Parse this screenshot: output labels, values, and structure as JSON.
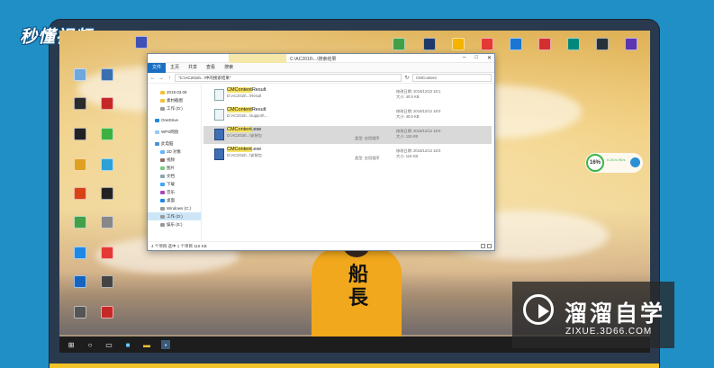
{
  "brand_logo": "秒懂视频",
  "watermark": {
    "title": "溜溜自学",
    "url": "ZIXUE.3D66.COM",
    "icon": "play-icon"
  },
  "wallpaper": {
    "shirt_text": "船長"
  },
  "explorer": {
    "title_path": "C:\\AC2016\\...\\搜索结果",
    "ribbon_tabs": [
      "文件",
      "主页",
      "共享",
      "查看",
      "搜索"
    ],
    "address": "\"C:\\AC2016\\...\\中的搜索结果\"",
    "search_value": "CMContent",
    "nav_items": [
      {
        "label": "2019.03.09",
        "icon": "folder-icon"
      },
      {
        "label": "素材截图",
        "icon": "folder-icon"
      },
      {
        "label": "工作 (D:)",
        "icon": "drive-icon"
      },
      {
        "label": "OneDrive",
        "icon": "cloud-icon"
      },
      {
        "label": "WPS网盘",
        "icon": "cloud-icon"
      },
      {
        "label": "此电脑",
        "icon": "pc-icon"
      },
      {
        "label": "3D 对象",
        "icon": "folder-icon"
      },
      {
        "label": "视频",
        "icon": "folder-icon"
      },
      {
        "label": "图片",
        "icon": "folder-icon"
      },
      {
        "label": "文档",
        "icon": "folder-icon"
      },
      {
        "label": "下载",
        "icon": "folder-icon"
      },
      {
        "label": "音乐",
        "icon": "folder-icon"
      },
      {
        "label": "桌面",
        "icon": "folder-icon"
      },
      {
        "label": "Windows (C:)",
        "icon": "drive-icon"
      },
      {
        "label": "工作 (D:)",
        "icon": "drive-icon"
      },
      {
        "label": "娱乐 (E:)",
        "icon": "drive-icon"
      }
    ],
    "files": [
      {
        "name_hl": "CMContent",
        "name_rest": "Result",
        "path": "D:\\AC2016\\...\\Result",
        "kind": "",
        "date": "修改日期: 2016/12/22 18:1",
        "size": "大小: 40.5 KB"
      },
      {
        "name_hl": "CMContent",
        "name_rest": "Result",
        "path": "D:\\AC2016\\...\\support\\...",
        "kind": "",
        "date": "修改日期: 2016/12/12 18:0",
        "size": "大小: 40.5 KB"
      },
      {
        "name_hl": "CMContent",
        "name_rest": ".exe",
        "path": "D:\\AC2016\\...\\安装包",
        "kind": "类型: 应用程序",
        "date": "修改日期: 2016/12/12 18:0",
        "size": "大小: 115 KB"
      },
      {
        "name_hl": "CMContent",
        "name_rest": ".exe",
        "path": "D:\\AC2016\\...\\安装包",
        "kind": "类型: 应用程序",
        "date": "修改日期: 2016/12/12 18:0",
        "size": "大小: 115 KB"
      }
    ],
    "status": "4 个项目   选中 1 个项目  115 KB"
  },
  "speed_widget": {
    "value": "16%",
    "label": "0.1K/s 0K/s"
  },
  "taskbar": [
    "start-icon",
    "search-icon",
    "taskview-icon",
    "app-icon",
    "explorer-icon",
    "app-icon"
  ]
}
